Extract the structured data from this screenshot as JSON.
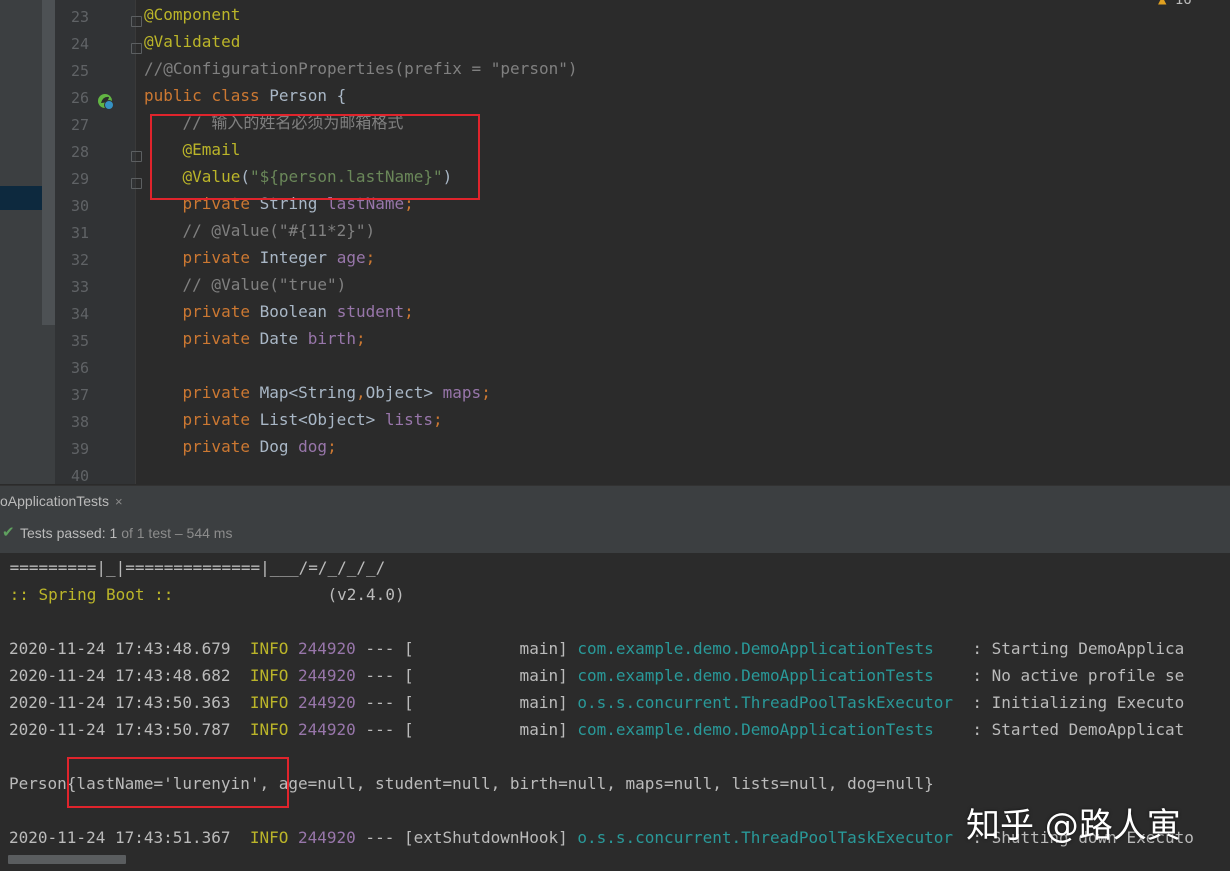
{
  "editor": {
    "warning_count": "16",
    "lines": [
      {
        "n": "23",
        "text": "@Component"
      },
      {
        "n": "24",
        "text": "@Validated"
      },
      {
        "n": "25",
        "text": "//@ConfigurationProperties(prefix = \"person\")"
      },
      {
        "n": "26",
        "text": "public class Person {"
      },
      {
        "n": "27",
        "text": "    // 输入的姓名必须为邮箱格式"
      },
      {
        "n": "28",
        "text": "    @Email"
      },
      {
        "n": "29",
        "text": "    @Value(\"${person.lastName}\")"
      },
      {
        "n": "30",
        "text": "    private String lastName;"
      },
      {
        "n": "31",
        "text": "    // @Value(\"#{11*2}\")"
      },
      {
        "n": "32",
        "text": "    private Integer age;"
      },
      {
        "n": "33",
        "text": "    // @Value(\"true\")"
      },
      {
        "n": "34",
        "text": "    private Boolean student;"
      },
      {
        "n": "35",
        "text": "    private Date birth;"
      },
      {
        "n": "36",
        "text": ""
      },
      {
        "n": "37",
        "text": "    private Map<String,Object> maps;"
      },
      {
        "n": "38",
        "text": "    private List<Object> lists;"
      },
      {
        "n": "39",
        "text": "    private Dog dog;"
      },
      {
        "n": "40",
        "text": ""
      }
    ]
  },
  "run_panel": {
    "tab_label": "oApplicationTests",
    "tab_close": "×",
    "status": {
      "passed_label": "Tests passed:",
      "passed_count": "1",
      "of_label": "of 1 test – 544 ms"
    }
  },
  "console": {
    "banner1": " =========|_|==============|___/=/_/_/_/",
    "banner2_a": " :: Spring Boot ::",
    "banner2_b": "                (v2.4.0)",
    "logs": [
      {
        "ts": "2020-11-24 17:43:48.679",
        "level": "INFO",
        "pid": "244920",
        "sep": " --- [           main] ",
        "logger": "com.example.demo.DemoApplicationTests",
        "msg": "    : Starting DemoApplica"
      },
      {
        "ts": "2020-11-24 17:43:48.682",
        "level": "INFO",
        "pid": "244920",
        "sep": " --- [           main] ",
        "logger": "com.example.demo.DemoApplicationTests",
        "msg": "    : No active profile se"
      },
      {
        "ts": "2020-11-24 17:43:50.363",
        "level": "INFO",
        "pid": "244920",
        "sep": " --- [           main] ",
        "logger": "o.s.s.concurrent.ThreadPoolTaskExecutor",
        "msg": "  : Initializing Executo"
      },
      {
        "ts": "2020-11-24 17:43:50.787",
        "level": "INFO",
        "pid": "244920",
        "sep": " --- [           main] ",
        "logger": "com.example.demo.DemoApplicationTests",
        "msg": "    : Started DemoApplicat"
      }
    ],
    "person_prefix": "Person",
    "person_highlight": "{lastName='lurenyin',",
    "person_rest": " age=null, student=null, birth=null, maps=null, lists=null, dog=null}",
    "shutdown": {
      "ts": "2020-11-24 17:43:51.367",
      "level": "INFO",
      "pid": "244920",
      "sep": " --- [extShutdownHook] ",
      "logger": "o.s.s.concurrent.ThreadPoolTaskExecutor",
      "msg": "  : Shutting down Executo"
    }
  },
  "watermark": "知乎 @路人寅",
  "colors": {
    "keyword": "#cc7832",
    "annotation": "#bbb529",
    "comment": "#808080",
    "string": "#6a8759",
    "field": "#9876aa",
    "logger": "#299999",
    "highlight_box": "#e0242c"
  }
}
